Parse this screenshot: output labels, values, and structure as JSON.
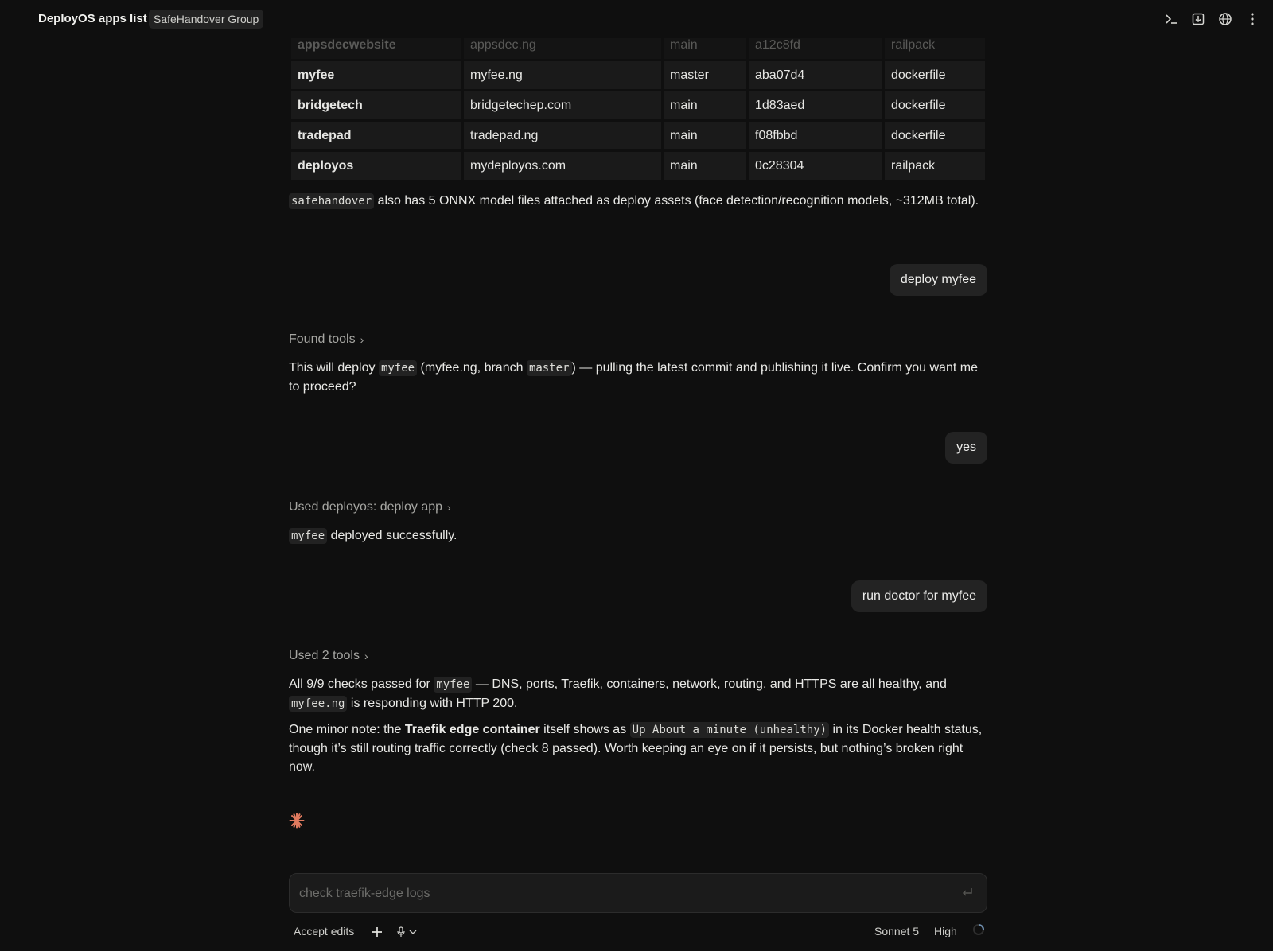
{
  "header": {
    "title": "DeployOS apps list",
    "org_badge": "SafeHandover Group",
    "icons": [
      "terminal-icon",
      "download-box-icon",
      "globe-icon",
      "more-vertical-icon"
    ]
  },
  "apps_table": {
    "rows": [
      {
        "name": "appsdecwebsite",
        "domain": "appsdec.ng",
        "branch": "main",
        "commit": "a12c8fd",
        "builder": "railpack"
      },
      {
        "name": "myfee",
        "domain": "myfee.ng",
        "branch": "master",
        "commit": "aba07d4",
        "builder": "dockerfile"
      },
      {
        "name": "bridgetech",
        "domain": "bridgetechep.com",
        "branch": "main",
        "commit": "1d83aed",
        "builder": "dockerfile"
      },
      {
        "name": "tradepad",
        "domain": "tradepad.ng",
        "branch": "main",
        "commit": "f08fbbd",
        "builder": "dockerfile"
      },
      {
        "name": "deployos",
        "domain": "mydeployos.com",
        "branch": "main",
        "commit": "0c28304",
        "builder": "railpack"
      }
    ]
  },
  "messages": {
    "assets_note": {
      "code": "safehandover",
      "text": " also has 5 ONNX model files attached as deploy assets (face detection/recognition models, ~312MB total)."
    },
    "user1": "deploy myfee",
    "tool1": "Found tools",
    "confirm": {
      "pre": "This will deploy ",
      "code1": "myfee",
      "mid": " (myfee.ng, branch ",
      "code2": "master",
      "post": ") — pulling the latest commit and publishing it live. Confirm you want me to proceed?"
    },
    "user2": "yes",
    "tool2": "Used deployos: deploy app",
    "deployed": {
      "code": "myfee",
      "text": " deployed successfully."
    },
    "user3": "run doctor for myfee",
    "tool3": "Used 2 tools",
    "doctor": {
      "pre": "All 9/9 checks passed for ",
      "code1": "myfee",
      "mid": " — DNS, ports, Traefik, containers, network, routing, and HTTPS are all healthy, and ",
      "code2": "myfee.ng",
      "post": " is responding with HTTP 200."
    },
    "note": {
      "pre": "One minor note: the ",
      "bold": "Traefik edge container",
      "mid": " itself shows as ",
      "code": "Up About a minute (unhealthy)",
      "post": " in its Docker health status, though it’s still routing traffic correctly (check 8 passed). Worth keeping an eye on if it persists, but nothing’s broken right now."
    }
  },
  "composer": {
    "placeholder": "check traefik-edge logs",
    "value": ""
  },
  "footer": {
    "accept_edits": "Accept edits",
    "model": "Sonnet 5",
    "effort": "High"
  },
  "colors": {
    "background": "#0f0f0f",
    "spark": "#e07a5f"
  }
}
